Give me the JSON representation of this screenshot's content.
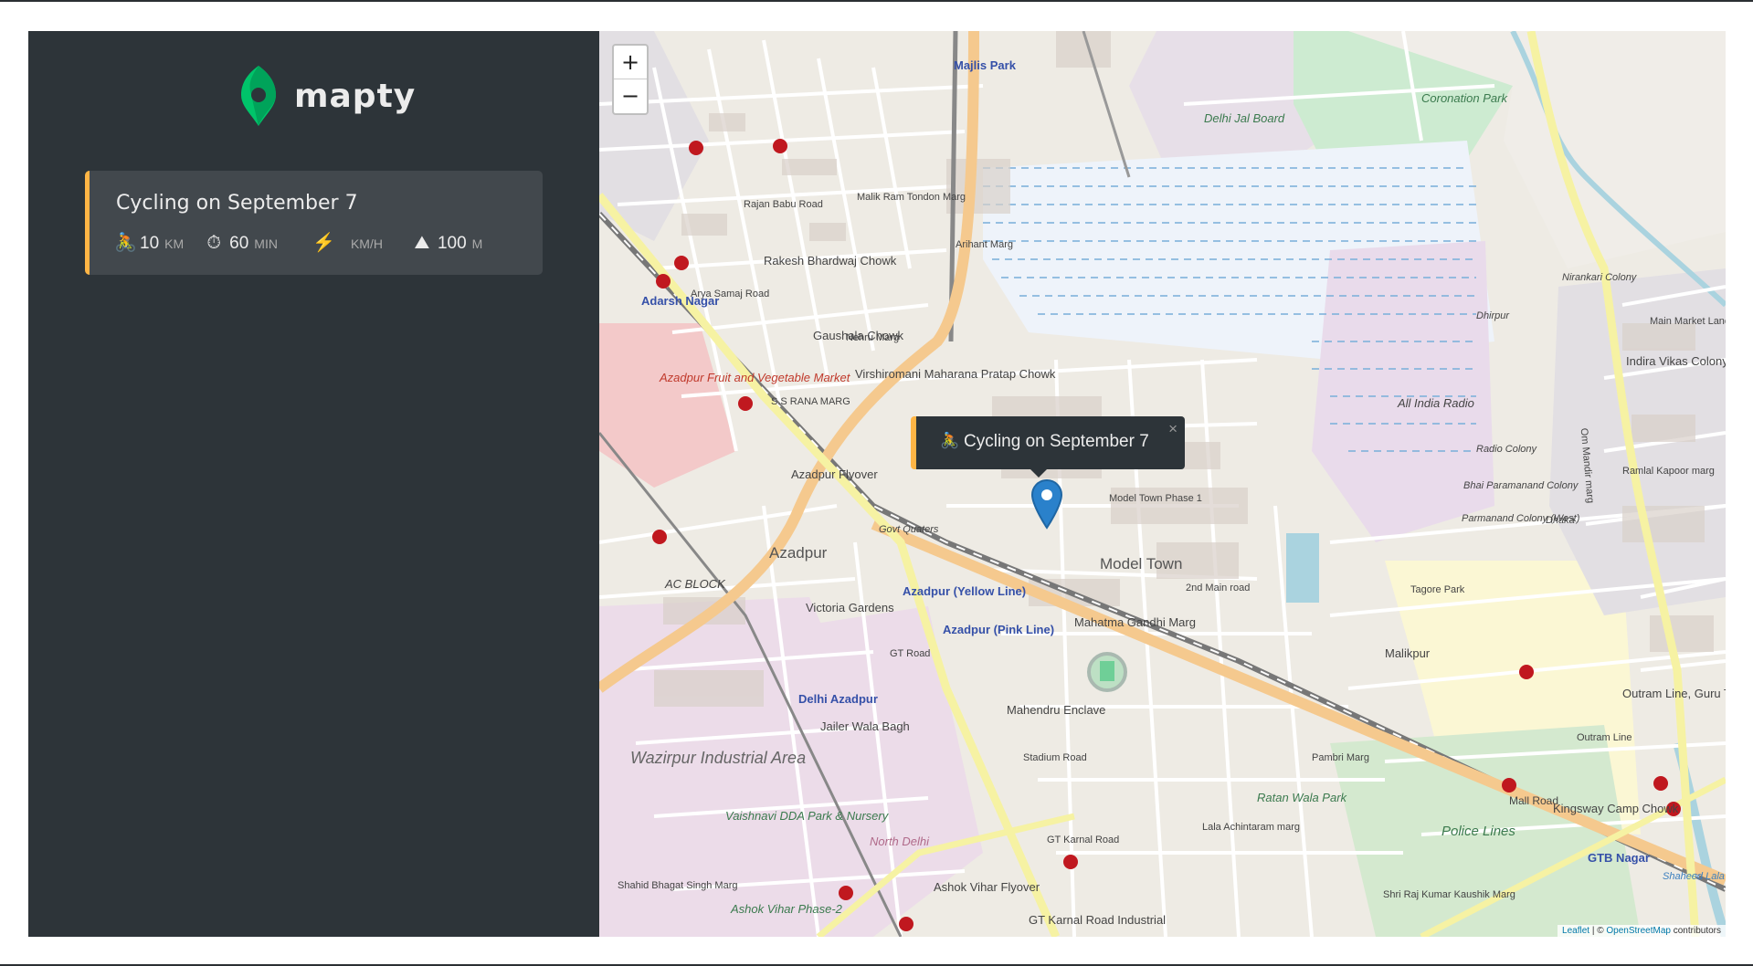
{
  "app": {
    "name": "mapty"
  },
  "workout": {
    "title": "Cycling on September 7",
    "type": "cycling",
    "details": [
      {
        "icon": "🚴",
        "value": "10",
        "unit": "km"
      },
      {
        "icon": "⏱",
        "value": "60",
        "unit": "min"
      },
      {
        "icon": "⚡️",
        "value": "",
        "unit": "km/h"
      },
      {
        "icon": "⛰",
        "value": "100",
        "unit": "m"
      }
    ]
  },
  "colors": {
    "accent_cycling": "#ffb545",
    "sidebar_bg": "#2d3439",
    "card_bg": "#42484d",
    "logo_green": "#00c46a"
  },
  "map": {
    "zoom_in": "+",
    "zoom_out": "−",
    "popup": {
      "icon": "🚴",
      "text": "Cycling on September 7",
      "close": "×"
    },
    "attribution": {
      "leaflet": "Leaflet",
      "sep": " | © ",
      "osm": "OpenStreetMap",
      "suffix": " contributors"
    },
    "labels": [
      "Majlis Park",
      "Delhi Jal Board",
      "Coronation Park",
      "Adarsh Nagar",
      "Rakesh Bhardwaj Chowk",
      "Gaushala Chowk",
      "Virshiromani Maharana Pratap Chowk",
      "Azadpur Fruit and Vegetable Market",
      "Azadpur Flyover",
      "Azadpur",
      "AC BLOCK",
      "Victoria Gardens",
      "Azadpur (Yellow Line)",
      "Azadpur (Pink Line)",
      "Delhi Azadpur",
      "Jailer Wala Bagh",
      "Wazirpur Industrial Area",
      "Vaishnavi DDA Park & Nursery",
      "North Delhi",
      "Ashok Vihar Phase-2",
      "Ashok Vihar Flyover",
      "GT Karnal Road Industrial",
      "Mahendru Enclave",
      "Model Town",
      "Model Town Phase 1",
      "Govt Quaters",
      "Mahatma Gandhi Marg",
      "2nd Main road",
      "Stadium Road",
      "Ratan Wala Park",
      "Lala Achintaram marg",
      "Pambri Marg",
      "Malikpur",
      "Tagore Park",
      "All India Radio",
      "Radio Colony",
      "Bhai Paramanand Colony",
      "Parmanand Colony (West)",
      "Dhaka",
      "Nirankari Colony",
      "Dhirpur",
      "Indira Vikas Colony",
      "Main Market Lane",
      "Om Mandir marg",
      "Ramlal Kapoor marg",
      "Outram Line, Guru Tegh Bahadur Nagar",
      "Outram Line",
      "Kingsway Camp Chowk",
      "GTB Nagar",
      "Police Lines",
      "Mall Road",
      "Shri Raj Kumar Kaushik Marg",
      "GT Road",
      "GT Karnal Road",
      "Arihant Marg",
      "Malik Ram Tondon Marg",
      "Rajan Babu Road",
      "Arya Samaj Road",
      "Nehru Marg",
      "S.S RANA MARG",
      "Shahid Bhagat Singh Marg",
      "Shaheed Lala Narain Marg",
      "Sahibi River"
    ]
  }
}
